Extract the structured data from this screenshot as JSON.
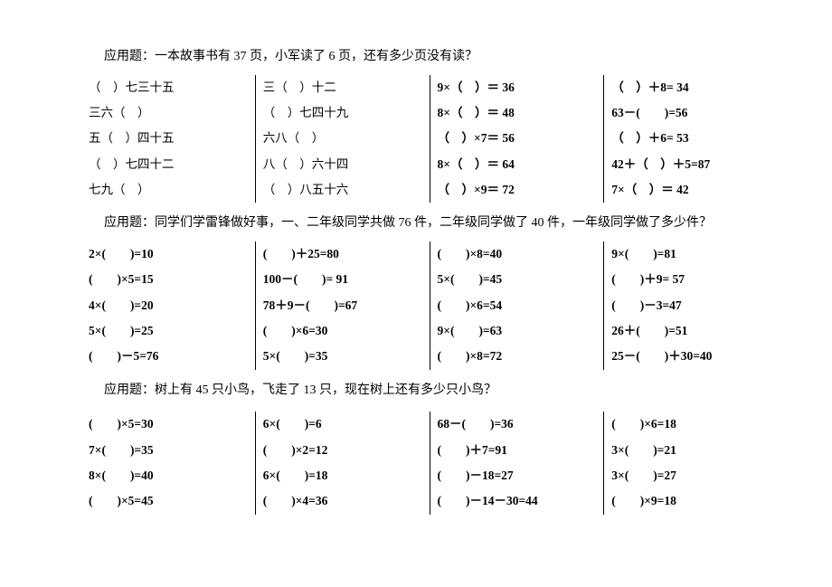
{
  "problem1": "应用题：一本故事书有 37 页，小军读了 6 页，还有多少页没有读？",
  "section1": {
    "col1": [
      "（　）七三十五",
      "三六（　）",
      "五（　）四十五",
      "（　）七四十二",
      "七九（　）"
    ],
    "col2": [
      "三（　）十二",
      "（　）七四十九",
      "六八（　）",
      "八（　）六十四",
      "（　）八五十六"
    ],
    "col3": [
      "9×（　）＝ 36",
      "8×（　）＝ 48",
      "（　）×7＝ 56",
      "8×（　）＝ 64",
      "（　）×9＝ 72"
    ],
    "col4": [
      "（　）＋8= 34",
      "63－(　　)=56",
      "（　）＋6= 53",
      "42＋（　）＋5=87",
      "7×（　）＝ 42"
    ]
  },
  "problem2": "应用题：同学们学雷锋做好事，一、二年级同学共做 76 件，二年级同学做了 40 件，一年级同学做了多少件？",
  "section2": {
    "col1": [
      "2×(　　)=10",
      "(　　)×5=15",
      "4×(　　)=20",
      "5×(　　)=25",
      "(　　)－5=76"
    ],
    "col2": [
      "(　　)＋25=80",
      "100－(　　)= 91",
      "78＋9－(　　)=67",
      "(　　)×6=30",
      "5×(　　)=35"
    ],
    "col3": [
      "(　　)×8=40",
      "5×(　　)=45",
      "(　　)×6=54",
      "9×(　　)=63",
      "(　　)×8=72"
    ],
    "col4": [
      "9×(　　)=81",
      "(　　)＋9= 57",
      "(　　)－3=47",
      "26＋(　　)=51",
      "25－(　　)＋30=40"
    ]
  },
  "problem3": "应用题：树上有 45 只小鸟，飞走了 13 只，现在树上还有多少只小鸟？",
  "section3": {
    "col1": [
      "(　　)×5=30",
      "7×(　　)=35",
      "8×(　　)=40",
      "(　　)×5=45"
    ],
    "col2": [
      "6×(　　)=6",
      "(　　)×2=12",
      "6×(　　)=18",
      "(　　)×4=36"
    ],
    "col3": [
      "68－(　　)=36",
      "(　　)＋7=91",
      "(　　)－18=27",
      "(　　)－14－30=44"
    ],
    "col4": [
      "(　　)×6=18",
      "3×(　　)=21",
      "3×(　　)=27",
      "(　　)×9=18"
    ]
  }
}
